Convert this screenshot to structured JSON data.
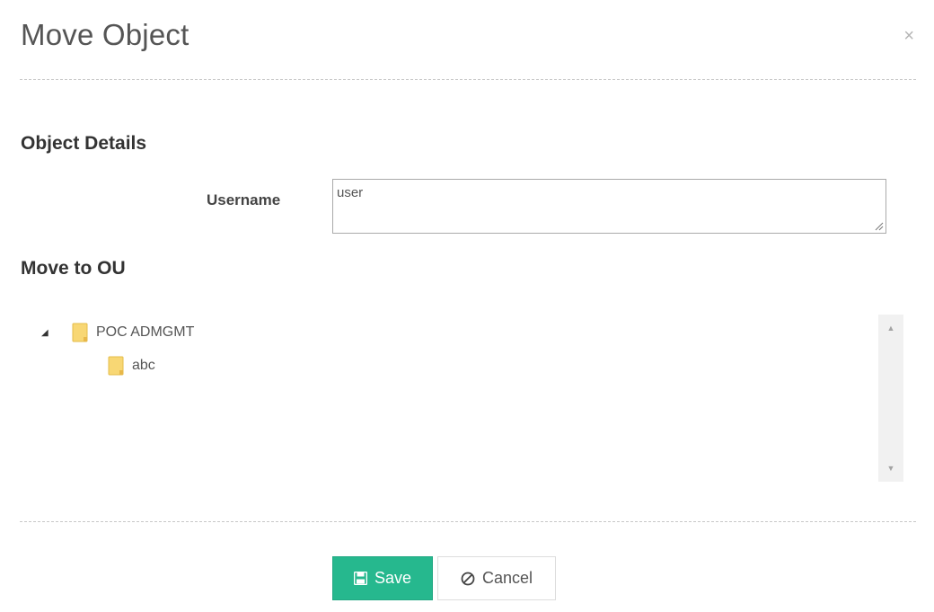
{
  "dialog": {
    "title": "Move Object",
    "close_label": "×"
  },
  "object_details": {
    "heading": "Object Details",
    "username_label": "Username",
    "username_value": "user"
  },
  "move_to_ou": {
    "heading": "Move to OU",
    "tree": [
      {
        "label": "POC ADMGMT",
        "expanded": true,
        "icon": "folder-icon"
      },
      {
        "label": "abc",
        "icon": "folder-icon"
      }
    ]
  },
  "footer": {
    "save_label": "Save",
    "cancel_label": "Cancel"
  },
  "colors": {
    "accent": "#26b88e",
    "folder": "#f8d774"
  }
}
